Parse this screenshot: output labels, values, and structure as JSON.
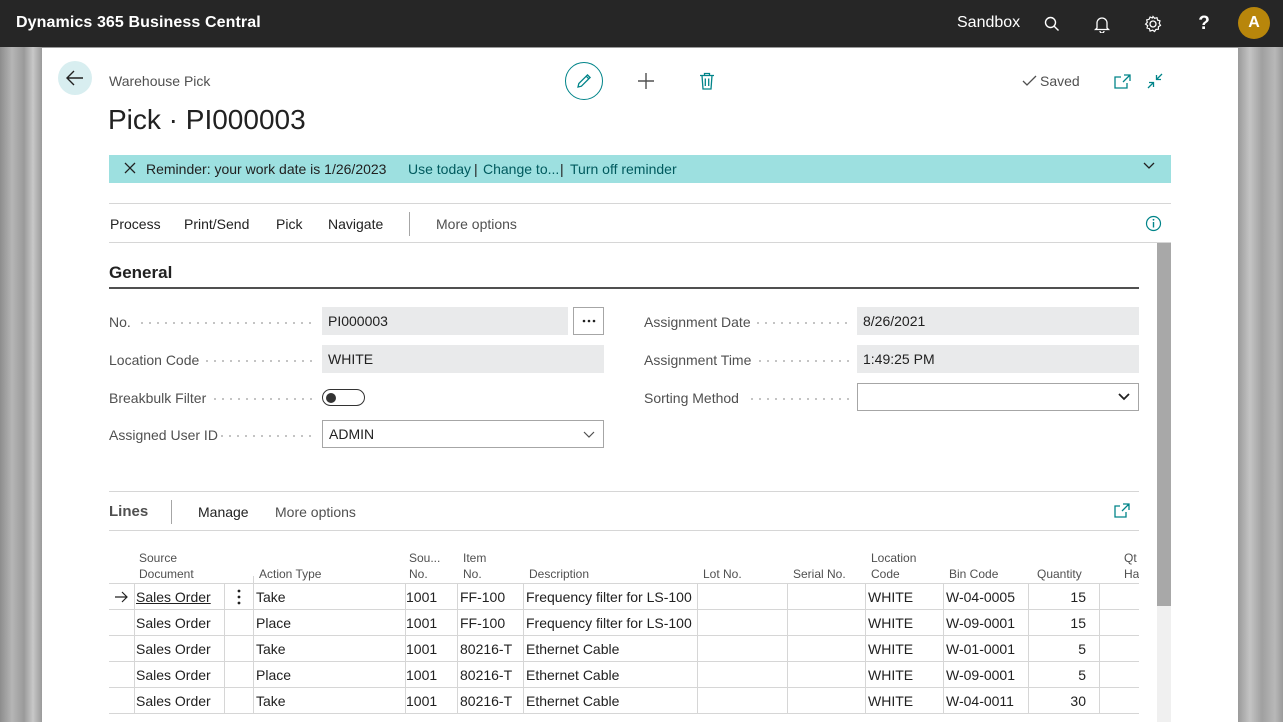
{
  "topbar": {
    "app_title": "Dynamics 365 Business Central",
    "environment": "Sandbox",
    "avatar_initial": "A",
    "help_glyph": "?"
  },
  "header": {
    "breadcrumb": "Warehouse Pick",
    "title": "Pick · PI000003",
    "saved_label": "Saved"
  },
  "reminder": {
    "text": "Reminder: your work date is 1/26/2023",
    "use_today": "Use today",
    "change_to": "Change to...",
    "turn_off": "Turn off reminder",
    "separator": "|"
  },
  "actions": {
    "items": [
      "Process",
      "Print/Send",
      "Pick",
      "Navigate"
    ],
    "more": "More options"
  },
  "general": {
    "title": "General",
    "no_label": "No.",
    "no_value": "PI000003",
    "location_label": "Location Code",
    "location_value": "WHITE",
    "breakbulk_label": "Breakbulk Filter",
    "breakbulk_on": false,
    "user_label": "Assigned User ID",
    "user_value": "ADMIN",
    "assign_date_label": "Assignment Date",
    "assign_date_value": "8/26/2021",
    "assign_time_label": "Assignment Time",
    "assign_time_value": "1:49:25 PM",
    "sorting_label": "Sorting Method",
    "sorting_value": ""
  },
  "lines": {
    "title": "Lines",
    "manage": "Manage",
    "more": "More options",
    "columns": {
      "source_document": [
        "Source",
        "Document"
      ],
      "action_type": "Action Type",
      "source_no": [
        "Sou...",
        "No."
      ],
      "item_no": [
        "Item",
        "No."
      ],
      "description": "Description",
      "lot_no": "Lot No.",
      "serial_no": "Serial No.",
      "location_code": [
        "Location",
        "Code"
      ],
      "bin_code": "Bin Code",
      "quantity": "Quantity",
      "qty_handled": [
        "Qt",
        "Ha"
      ]
    },
    "rows": [
      {
        "source_document": "Sales Order",
        "action_type": "Take",
        "source_no": "1001",
        "item_no": "FF-100",
        "description": "Frequency filter for LS-100",
        "lot_no": "",
        "serial_no": "",
        "location_code": "WHITE",
        "bin_code": "W-04-0005",
        "quantity": "15"
      },
      {
        "source_document": "Sales Order",
        "action_type": "Place",
        "source_no": "1001",
        "item_no": "FF-100",
        "description": "Frequency filter for LS-100",
        "lot_no": "",
        "serial_no": "",
        "location_code": "WHITE",
        "bin_code": "W-09-0001",
        "quantity": "15"
      },
      {
        "source_document": "Sales Order",
        "action_type": "Take",
        "source_no": "1001",
        "item_no": "80216-T",
        "description": "Ethernet Cable",
        "lot_no": "",
        "serial_no": "",
        "location_code": "WHITE",
        "bin_code": "W-01-0001",
        "quantity": "5"
      },
      {
        "source_document": "Sales Order",
        "action_type": "Place",
        "source_no": "1001",
        "item_no": "80216-T",
        "description": "Ethernet Cable",
        "lot_no": "",
        "serial_no": "",
        "location_code": "WHITE",
        "bin_code": "W-09-0001",
        "quantity": "5"
      },
      {
        "source_document": "Sales Order",
        "action_type": "Take",
        "source_no": "1001",
        "item_no": "80216-T",
        "description": "Ethernet Cable",
        "lot_no": "",
        "serial_no": "",
        "location_code": "WHITE",
        "bin_code": "W-04-0011",
        "quantity": "30"
      }
    ]
  },
  "colors": {
    "accent": "#008489",
    "reminder_bg": "#9de0e0",
    "topbar_bg": "#262626",
    "avatar_bg": "#b8860b"
  },
  "icons": [
    "search-icon",
    "bell-icon",
    "gear-icon",
    "help-icon",
    "back-arrow-icon",
    "pencil-icon",
    "plus-icon",
    "trash-icon",
    "check-icon",
    "open-new-window-icon",
    "collapse-icon",
    "close-icon",
    "chevron-down-icon",
    "info-icon",
    "row-arrow-icon",
    "row-menu-icon",
    "expand-icon",
    "ellipsis-icon"
  ]
}
